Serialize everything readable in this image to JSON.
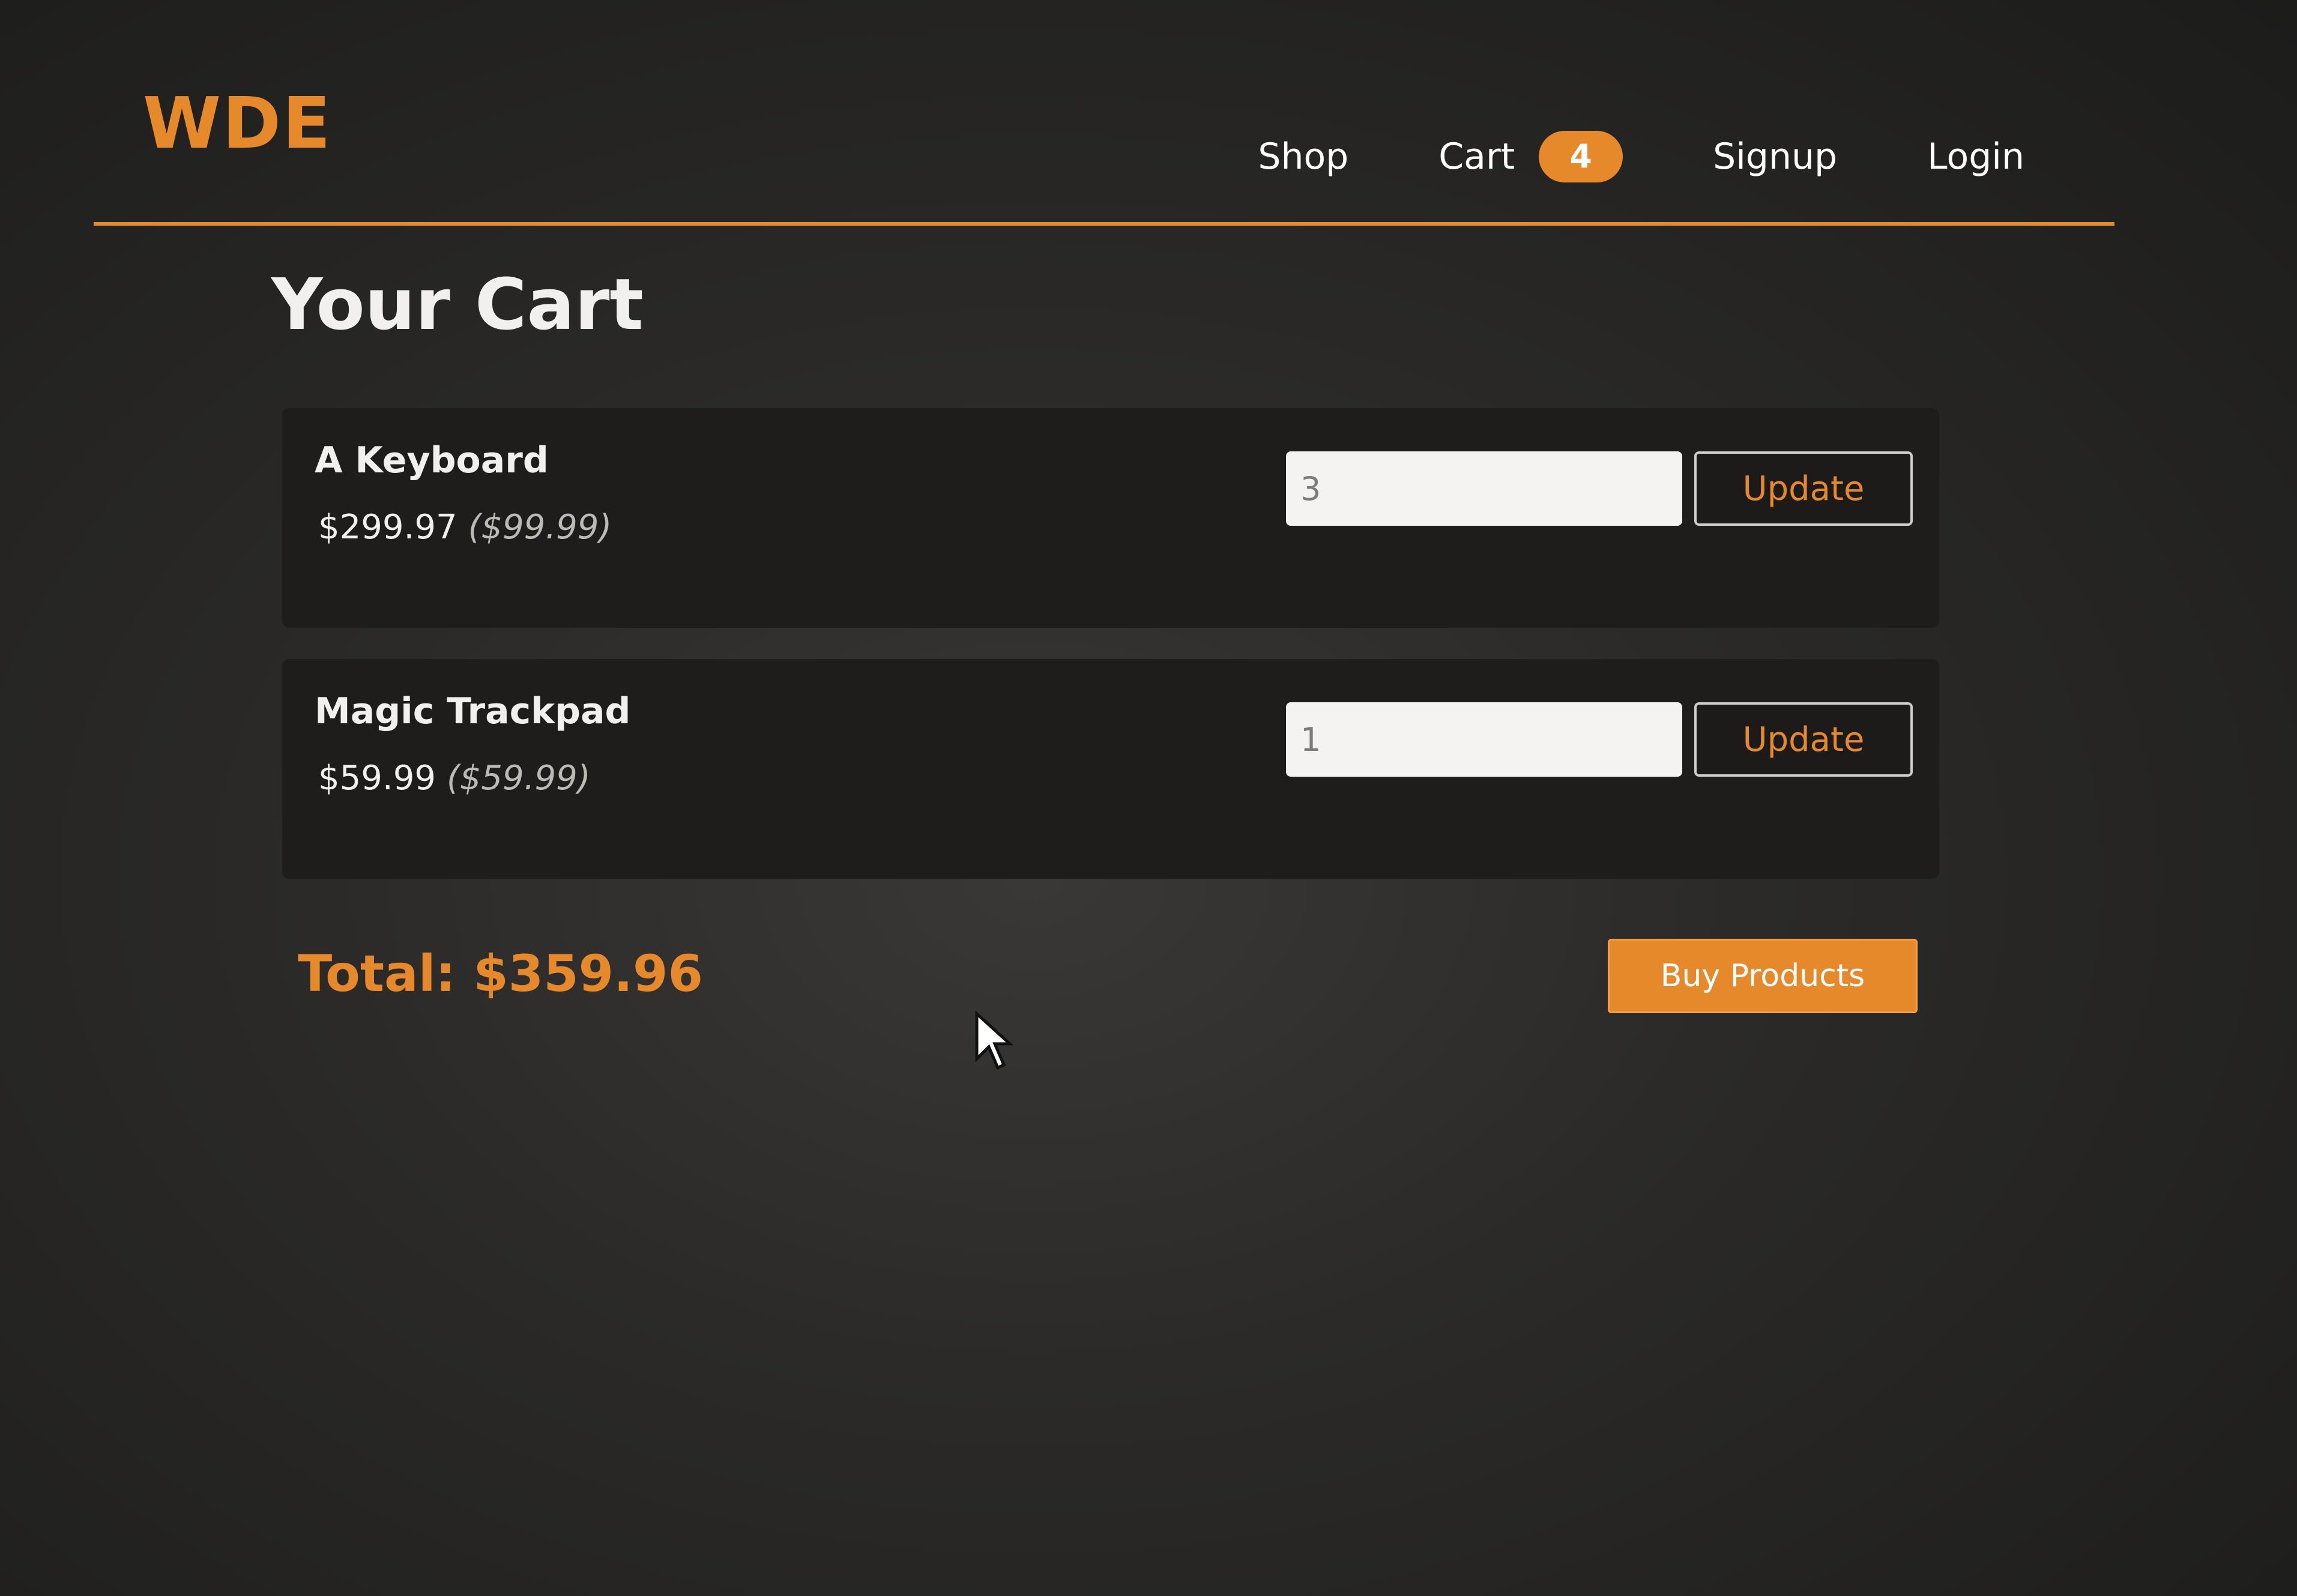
{
  "header": {
    "brand": "WDE",
    "nav": {
      "shop": "Shop",
      "cart": "Cart",
      "cart_count": "4",
      "signup": "Signup",
      "login": "Login"
    }
  },
  "cart": {
    "title": "Your Cart",
    "items": [
      {
        "name": "A Keyboard",
        "line_total": "$299.97",
        "unit_price": "($99.99)",
        "quantity": "3",
        "update_label": "Update"
      },
      {
        "name": "Magic Trackpad",
        "line_total": "$59.99",
        "unit_price": "($59.99)",
        "quantity": "1",
        "update_label": "Update"
      }
    ],
    "total": "Total: $359.96",
    "buy_label": "Buy Products"
  },
  "colors": {
    "accent": "#e6892b",
    "background": "#262524",
    "card": "#1e1d1c"
  },
  "icons": {
    "cursor": "mouse-pointer-icon"
  }
}
